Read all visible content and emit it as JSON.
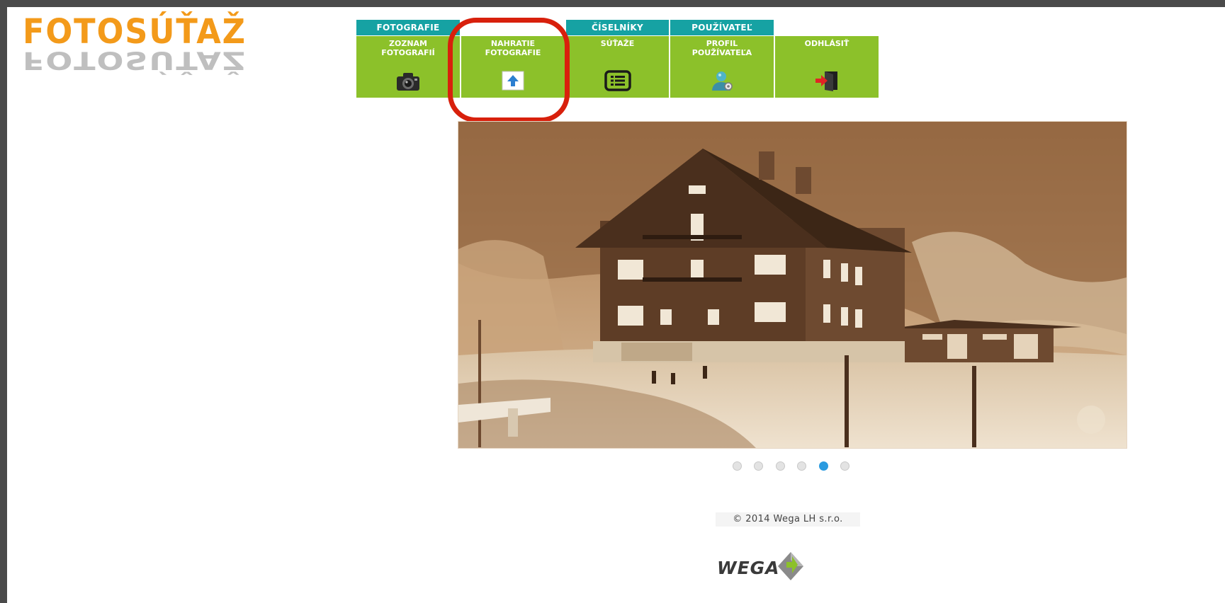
{
  "logo": {
    "text": "FOTOSÚŤAŽ",
    "color": "#f39a1a"
  },
  "nav": {
    "groups": [
      {
        "label": "FOTOGRAFIE"
      },
      {
        "label": "ČÍSELNÍKY"
      },
      {
        "label": "POUŽÍVATEĽ"
      }
    ],
    "items": [
      {
        "line1": "ZOZNAM",
        "line2": "FOTOGRAFIÍ",
        "icon": "camera-icon"
      },
      {
        "line1": "NAHRATIE",
        "line2": "FOTOGRAFIE",
        "icon": "upload-icon"
      },
      {
        "line1": "SÚŤAŽE",
        "line2": "",
        "icon": "list-icon"
      },
      {
        "line1": "PROFIL",
        "line2": "POUŽÍVATEĽA",
        "icon": "user-profile-icon"
      },
      {
        "line1": "ODHLÁSIŤ",
        "line2": "",
        "icon": "logout-icon"
      }
    ],
    "colors": {
      "group_tab": "#16a2a3",
      "item": "#8cc12a",
      "highlight": "#d8200c"
    }
  },
  "slider": {
    "slide_count": 6,
    "active_index": 4
  },
  "footer": {
    "copyright": "© 2014 Wega LH s.r.o.",
    "brand": "WEGA"
  }
}
